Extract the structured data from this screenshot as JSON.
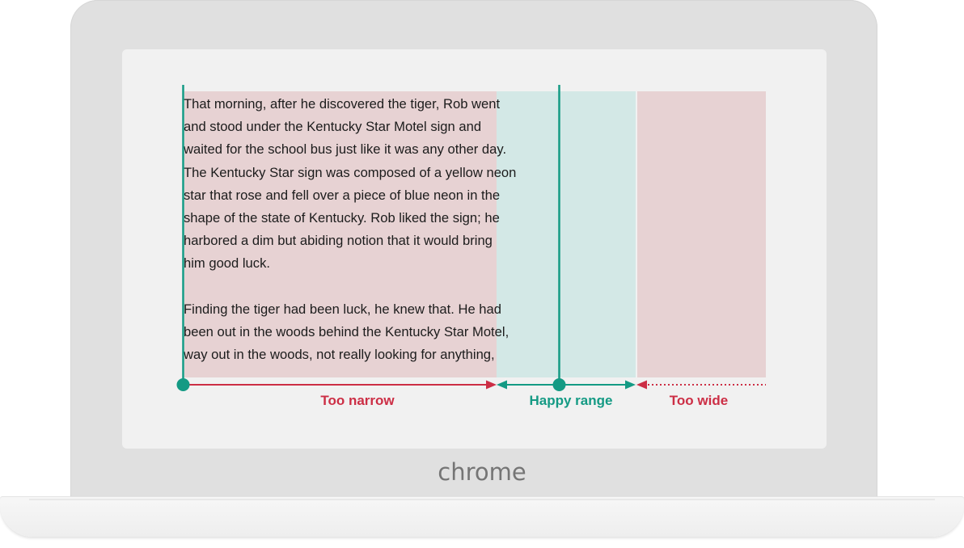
{
  "device": {
    "brand": "chrome"
  },
  "reading_text": {
    "paragraphs": [
      [
        "That morning, after he discovered the tiger, Rob went",
        "and stood under the Kentucky Star Motel sign and",
        "waited for the school bus just like it was any other day.",
        "The Kentucky Star sign was composed of a yellow neon",
        "star that rose and fell over a piece of blue neon in the",
        "shape of the state of Kentucky. Rob liked the sign; he",
        "harbored a dim but abiding notion that it would bring",
        "him good luck."
      ],
      [
        "Finding the tiger had been luck, he knew that. He had",
        "been out in the woods behind the Kentucky Star Motel,",
        "way out in the woods, not really looking for anything,"
      ]
    ]
  },
  "ranges": {
    "too_narrow": {
      "label": "Too narrow"
    },
    "happy_range": {
      "label": "Happy range"
    },
    "too_wide": {
      "label": "Too wide"
    }
  },
  "colors": {
    "bad": "#cc2e45",
    "good": "#149a84",
    "bad_band": "#e7d2d3",
    "good_band": "#d3e8e6"
  }
}
